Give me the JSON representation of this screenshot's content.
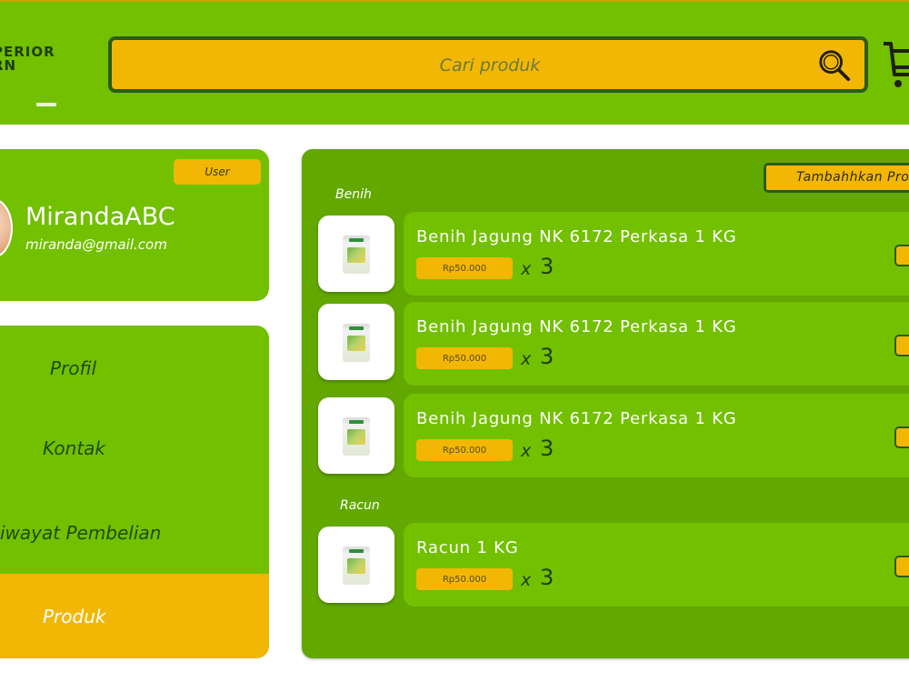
{
  "header": {
    "logo_lines": [
      "PERIOR",
      "RN"
    ],
    "search": {
      "placeholder": "Cari produk"
    },
    "icons": {
      "search": "search-icon",
      "cart": "cart-icon"
    }
  },
  "profile": {
    "badge": "User",
    "username": "MirandaABC",
    "email": "miranda@gmail.com"
  },
  "menu": {
    "items": [
      {
        "label": "Profil",
        "active": false
      },
      {
        "label": "Kontak",
        "active": false
      },
      {
        "label": "iwayat Pembelian",
        "active": false
      },
      {
        "label": "Produk",
        "active": true
      }
    ]
  },
  "products": {
    "add_button": "Tambahhkan Pro",
    "sections": [
      {
        "label": "Benih",
        "items": [
          {
            "name": "Benih Jagung NK 6172 Perkasa 1 KG",
            "price": "Rp50.000",
            "x": "x",
            "qty": "3"
          },
          {
            "name": "Benih Jagung NK 6172 Perkasa 1 KG",
            "price": "Rp50.000",
            "x": "x",
            "qty": "3"
          },
          {
            "name": "Benih Jagung NK 6172 Perkasa 1 KG",
            "price": "Rp50.000",
            "x": "x",
            "qty": "3"
          }
        ]
      },
      {
        "label": "Racun",
        "items": [
          {
            "name": "Racun 1 KG",
            "price": "Rp50.000",
            "x": "x",
            "qty": "3"
          }
        ]
      }
    ]
  },
  "colors": {
    "green": "#72c000",
    "panel_green": "#62a800",
    "yellow": "#f2b705",
    "dark_green": "#2d5a1a"
  }
}
